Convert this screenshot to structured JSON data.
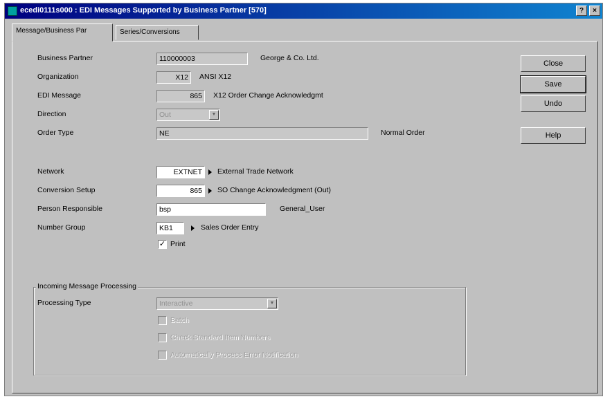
{
  "window": {
    "title": "ecedi0111s000 : EDI Messages Supported by Business Partner [570]",
    "help_button": "?",
    "close_button": "×"
  },
  "tabs": [
    {
      "label": "Message/Business Par",
      "active": true
    },
    {
      "label": "Series/Conversions",
      "active": false
    }
  ],
  "form": {
    "business_partner": {
      "label": "Business Partner",
      "value": "110000003",
      "description": "George & Co. Ltd."
    },
    "organization": {
      "label": "Organization",
      "value": "X12",
      "description": "ANSI X12"
    },
    "edi_message": {
      "label": "EDI Message",
      "value": "865",
      "description": "X12 Order Change Acknowledgmt"
    },
    "direction": {
      "label": "Direction",
      "value": "Out"
    },
    "order_type": {
      "label": "Order Type",
      "value": "NE",
      "description": "Normal Order"
    },
    "network": {
      "label": "Network",
      "value": "EXTNET",
      "description": "External Trade Network"
    },
    "conversion_setup": {
      "label": "Conversion Setup",
      "value": "865",
      "description": "SO Change Acknowledgment (Out)"
    },
    "person_responsible": {
      "label": "Person Responsible",
      "value": "bsp",
      "description": "General_User"
    },
    "number_group": {
      "label": "Number Group",
      "value": "KB1",
      "description": "Sales Order Entry"
    },
    "print": {
      "label": "Print",
      "checked": true
    }
  },
  "incoming": {
    "group_title": "Incoming Message Processing",
    "processing_type": {
      "label": "Processing Type",
      "value": "Interactive"
    },
    "options": [
      {
        "label": "Batch",
        "checked": false
      },
      {
        "label": "Check Standard Item Numbers",
        "checked": false
      },
      {
        "label": "Automatically Process Error Notification",
        "checked": false
      }
    ]
  },
  "buttons": {
    "close": "Close",
    "save": "Save",
    "undo": "Undo",
    "help": "Help"
  },
  "colors": {
    "titlebar_start": "#000080",
    "titlebar_end": "#1084d0",
    "face": "#c0c0c0"
  }
}
